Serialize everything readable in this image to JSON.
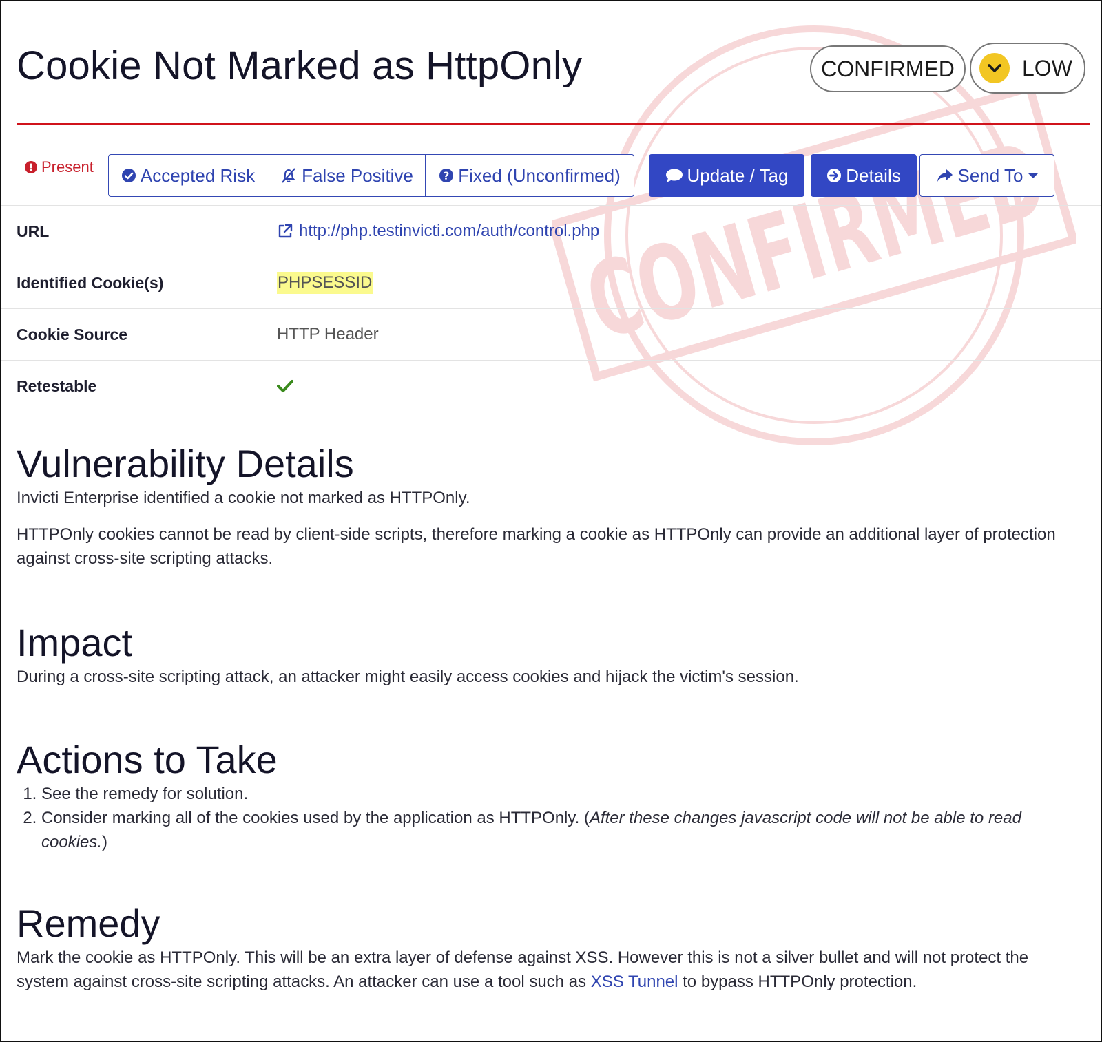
{
  "header": {
    "title": "Cookie Not Marked as HttpOnly",
    "status_label": "CONFIRMED",
    "severity_label": "LOW",
    "severity_color": "#f2c623",
    "accent_line_color": "#d0131b",
    "watermark_text": "CONFIRMED"
  },
  "toolbar": {
    "state_label": "Present",
    "state_icon": "exclamation-circle-icon",
    "buttons": [
      {
        "label": "Accepted Risk",
        "icon": "check-circle-icon"
      },
      {
        "label": "False Positive",
        "icon": "bell-slash-icon"
      },
      {
        "label": "Fixed (Unconfirmed)",
        "icon": "question-circle-icon"
      },
      {
        "label": "Update / Tag",
        "icon": "comment-icon"
      },
      {
        "label": "Details",
        "icon": "arrow-circle-right-icon"
      },
      {
        "label": "Send To",
        "icon": "share-icon"
      }
    ],
    "primary_color": "#3247c4"
  },
  "details": {
    "url_label": "URL",
    "url_value": "http://php.testinvicti.com/auth/control.php",
    "cookies_label": "Identified Cookie(s)",
    "cookies_value": "PHPSESSID",
    "source_label": "Cookie Source",
    "source_value": "HTTP Header",
    "retestable_label": "Retestable",
    "retestable_icon": "check-icon"
  },
  "vulnerability": {
    "heading": "Vulnerability Details",
    "p1": "Invicti Enterprise identified a cookie not marked as HTTPOnly.",
    "p2": "HTTPOnly cookies cannot be read by client-side scripts, therefore marking a cookie as HTTPOnly can provide an additional layer of protection against cross-site scripting attacks."
  },
  "impact": {
    "heading": "Impact",
    "p1": "During a cross-site scripting attack, an attacker might easily access cookies and hijack the victim's session."
  },
  "actions": {
    "heading": "Actions to Take",
    "item1": "See the remedy for solution.",
    "item2_text": "Consider marking all of the cookies used by the application as HTTPOnly. (",
    "item2_italic": "After these changes javascript code will not be able to read cookies.",
    "item2_end": ")"
  },
  "remedy": {
    "heading": "Remedy",
    "text_before": "Mark the cookie as HTTPOnly. This will be an extra layer of defense against XSS. However this is not a silver bullet and will not protect the system against cross-site scripting attacks. An attacker can use a tool such as ",
    "link_text": "XSS Tunnel",
    "text_after": " to bypass HTTPOnly protection."
  }
}
